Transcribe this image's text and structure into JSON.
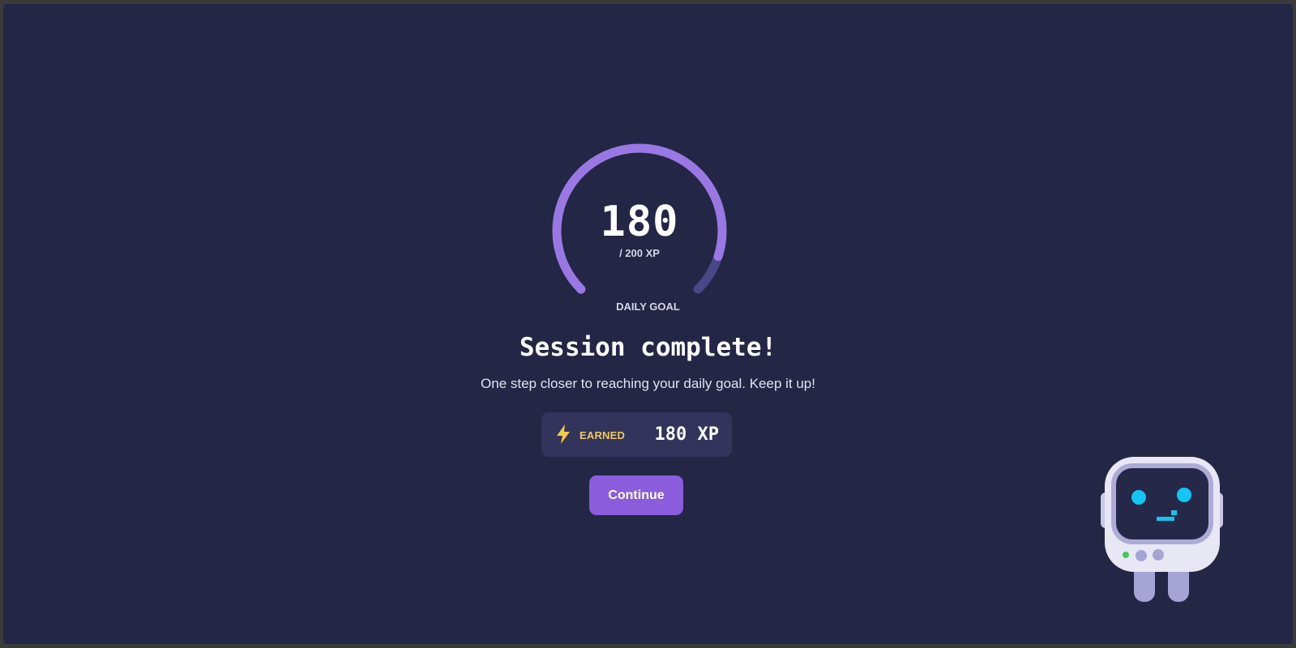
{
  "gauge": {
    "value": "180",
    "goal_text": "/ 200 XP",
    "label": "DAILY GOAL",
    "current": 180,
    "goal": 200,
    "colors": {
      "progress": "#9a78e4",
      "track": "#4a4787"
    }
  },
  "session": {
    "headline": "Session complete!",
    "message": "One step closer to reaching your daily goal. Keep it up!"
  },
  "earned": {
    "icon": "lightning-bolt-icon",
    "label": "EARNED",
    "value": "180 XP",
    "colors": {
      "icon": "#f6c945",
      "label": "#f0c95c"
    }
  },
  "actions": {
    "continue_label": "Continue"
  },
  "mascot": {
    "icon": "robot-mascot-icon"
  },
  "theme": {
    "background": "#242645",
    "accent": "#8b5cdc"
  }
}
